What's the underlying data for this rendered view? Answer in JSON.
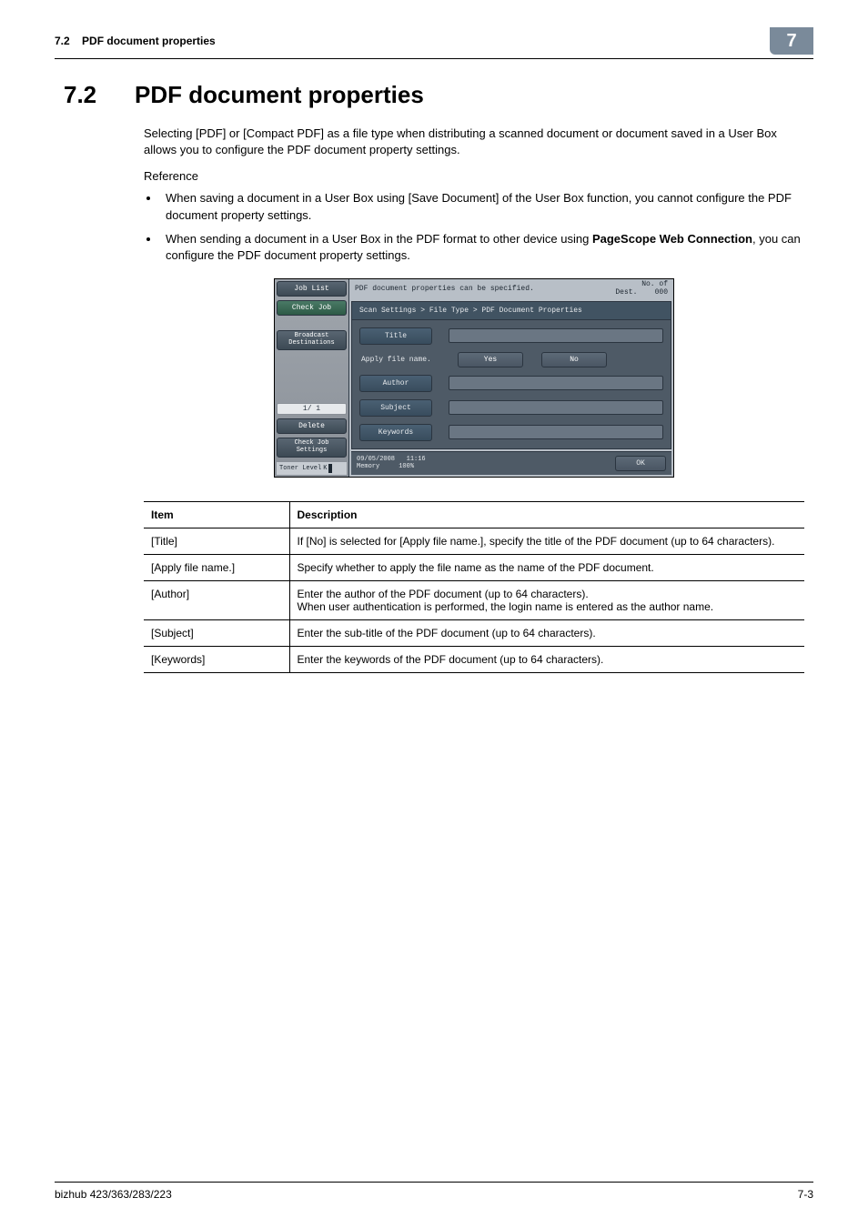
{
  "header": {
    "section_ref": "7.2",
    "section_name": "PDF document properties",
    "chapter_tab": "7"
  },
  "heading": {
    "number": "7.2",
    "title": "PDF document properties"
  },
  "intro_para": "Selecting [PDF] or [Compact PDF] as a file type when distributing a scanned document or document saved in a User Box allows you to configure the PDF document property settings.",
  "reference_label": "Reference",
  "bullets": [
    "When saving a document in a User Box using [Save Document] of the User Box function, you cannot configure the PDF document property settings.",
    "When sending a document in a User Box in the PDF format to other device using PageScope Web Connection, you can configure the PDF document property settings."
  ],
  "bullets_html": [
    "When saving a document in a User Box using [Save Document] of the User Box function, you cannot configure the PDF document property settings.",
    "When sending a document in a User Box in the PDF format to other device using <b>PageScope Web Connection</b>, you can configure the PDF document property settings."
  ],
  "panel": {
    "top_message": "PDF document properties can be specified.",
    "dest_label": "No. of\nDest.",
    "dest_count": "000",
    "breadcrumb": "Scan Settings > File Type > PDF Document Properties",
    "side": {
      "job_list": "Job List",
      "check_job": "Check Job",
      "broadcast": "Broadcast\nDestinations",
      "page": "1/  1",
      "delete": "Delete",
      "check_settings": "Check Job\nSettings",
      "toner": "Toner Level",
      "toner_k": "K"
    },
    "form": {
      "title": "Title",
      "apply_file_name": "Apply file name.",
      "yes": "Yes",
      "no": "No",
      "author": "Author",
      "subject": "Subject",
      "keywords": "Keywords"
    },
    "status": {
      "date": "09/05/2008",
      "time": "11:16",
      "memory_label": "Memory",
      "memory_value": "100%",
      "ok": "OK"
    }
  },
  "table": {
    "head_item": "Item",
    "head_desc": "Description",
    "rows": [
      {
        "item": "[Title]",
        "desc": "If [No] is selected for [Apply file name.], specify the title of the PDF document (up to 64 characters)."
      },
      {
        "item": "[Apply file name.]",
        "desc": "Specify whether to apply the file name as the name of the PDF document."
      },
      {
        "item": "[Author]",
        "desc": "Enter the author of the PDF document (up to 64 characters).\nWhen user authentication is performed, the login name is entered as the author name."
      },
      {
        "item": "[Subject]",
        "desc": "Enter the sub-title of the PDF document (up to 64 characters)."
      },
      {
        "item": "[Keywords]",
        "desc": "Enter the keywords of the PDF document (up to 64 characters)."
      }
    ]
  },
  "footer": {
    "model": "bizhub 423/363/283/223",
    "page": "7-3"
  }
}
